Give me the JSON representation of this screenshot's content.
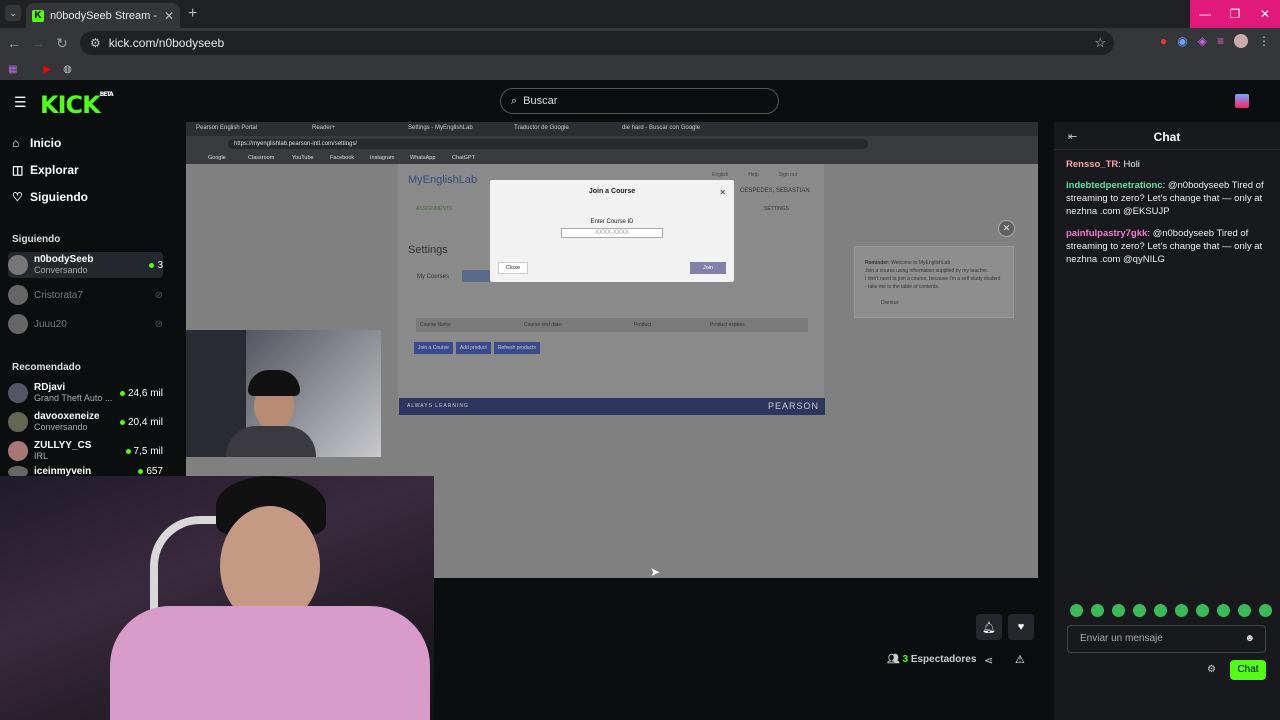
{
  "browser": {
    "tab_title": "n0bodySeeb Stream - Watch Li",
    "tab_favicon": "K",
    "url": "kick.com/n0bodyseeb"
  },
  "header": {
    "logo": "KICK",
    "logo_badge": "BETA",
    "search_placeholder": "Buscar"
  },
  "sidebar": {
    "nav": [
      {
        "label": "Inicio",
        "icon": "home-icon"
      },
      {
        "label": "Explorar",
        "icon": "compass-icon"
      },
      {
        "label": "Siguiendo",
        "icon": "heart-icon"
      }
    ],
    "following_title": "Siguiendo",
    "following": [
      {
        "name": "n0bodySeeb",
        "sub": "Conversando",
        "viewers": "3"
      },
      {
        "name": "Cristorata7",
        "sub": "",
        "viewers": ""
      },
      {
        "name": "Juuu20",
        "sub": "",
        "viewers": ""
      }
    ],
    "recommended_title": "Recomendado",
    "recommended": [
      {
        "name": "RDjavi",
        "sub": "Grand Theft Auto ...",
        "viewers": "24,6 mil"
      },
      {
        "name": "davooxeneize",
        "sub": "Conversando",
        "viewers": "20,4 mil"
      },
      {
        "name": "ZULLYY_CS",
        "sub": "IRL",
        "viewers": "7,5 mil"
      },
      {
        "name": "iceinmyvein",
        "sub": "",
        "viewers": "657"
      }
    ]
  },
  "stream": {
    "inner_tabs": [
      "Pearson English Portal",
      "Reader+",
      "Settings - MyEnglishLab",
      "Traductor de Google",
      "die hard - Buscar con Google"
    ],
    "inner_url": "https://myenglishlab.pearson-intl.com/settings/",
    "inner_bookmarks": [
      "Google",
      "Classroom",
      "YouTube",
      "Facebook",
      "Instagram",
      "WhatsApp",
      "ChatGPT"
    ],
    "site_logo": "MyEnglishLab",
    "page_title": "Settings",
    "user": "CESPEDES, SEBASTIAN",
    "top_links": [
      "English",
      "Help",
      "Sign out"
    ],
    "settings_tab": "SETTINGS",
    "assignments_tab": "ASSIGNMENTS",
    "my_courses": "My Courses",
    "table_headers": [
      "Course Name",
      "Course end date:",
      "Product",
      "Product expires"
    ],
    "buttons": [
      "Join a Course",
      "Add product",
      "Refresh products"
    ],
    "footer_left": "ALWAYS LEARNING",
    "footer_right": "PEARSON",
    "modal": {
      "title": "Join a Course",
      "label": "Enter Course ID",
      "placeholder": "XXXX-XXXX",
      "close": "Close",
      "join": "Join"
    },
    "reminder": {
      "title": "Reminder:",
      "text": "Welcome to MyEnglishLab",
      "line2": "Join a course using information supplied by my teacher.",
      "line3": "I don't need to join a course, because I'm a self study student - take me to the table of contents.",
      "dismiss": "Dismiss"
    }
  },
  "player": {
    "viewers_count": "3",
    "viewers_label": "Espectadores"
  },
  "chat": {
    "title": "Chat",
    "messages": [
      {
        "user": "Rensso_TR",
        "text": "Holi"
      },
      {
        "user": "indebtedpenetrationc",
        "text": "@n0bodyseeb Tired of streaming to zero? Let's change that — only at nezhna .com @EKSUJP"
      },
      {
        "user": "painfulpastry7gkk",
        "text": "@n0bodyseeb Tired of streaming to zero? Let's change that — only at nezhna .com @qyNILG"
      }
    ],
    "input_placeholder": "Enviar un mensaje",
    "send_label": "Chat"
  }
}
